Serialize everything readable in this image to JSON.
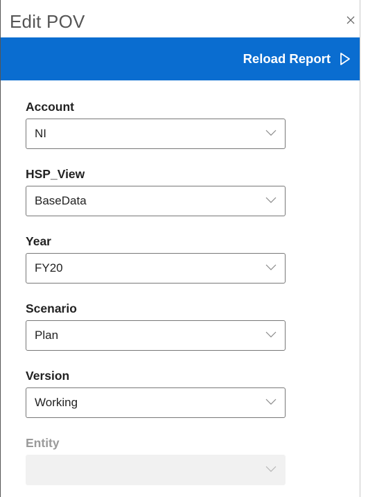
{
  "dialog": {
    "title": "Edit POV",
    "reload_label": "Reload Report"
  },
  "fields": [
    {
      "label": "Account",
      "value": "NI"
    },
    {
      "label": "HSP_View",
      "value": "BaseData"
    },
    {
      "label": "Year",
      "value": "FY20"
    },
    {
      "label": "Scenario",
      "value": "Plan"
    },
    {
      "label": "Version",
      "value": "Working"
    },
    {
      "label": "Entity",
      "value": ""
    }
  ],
  "colors": {
    "accent": "#0a6dd0",
    "disabled_text": "#9a9a9a",
    "disabled_bg": "#f1f1f1"
  },
  "icons": {
    "close": "close-icon",
    "reload": "play-icon",
    "dropdown": "chevron-down-icon"
  }
}
